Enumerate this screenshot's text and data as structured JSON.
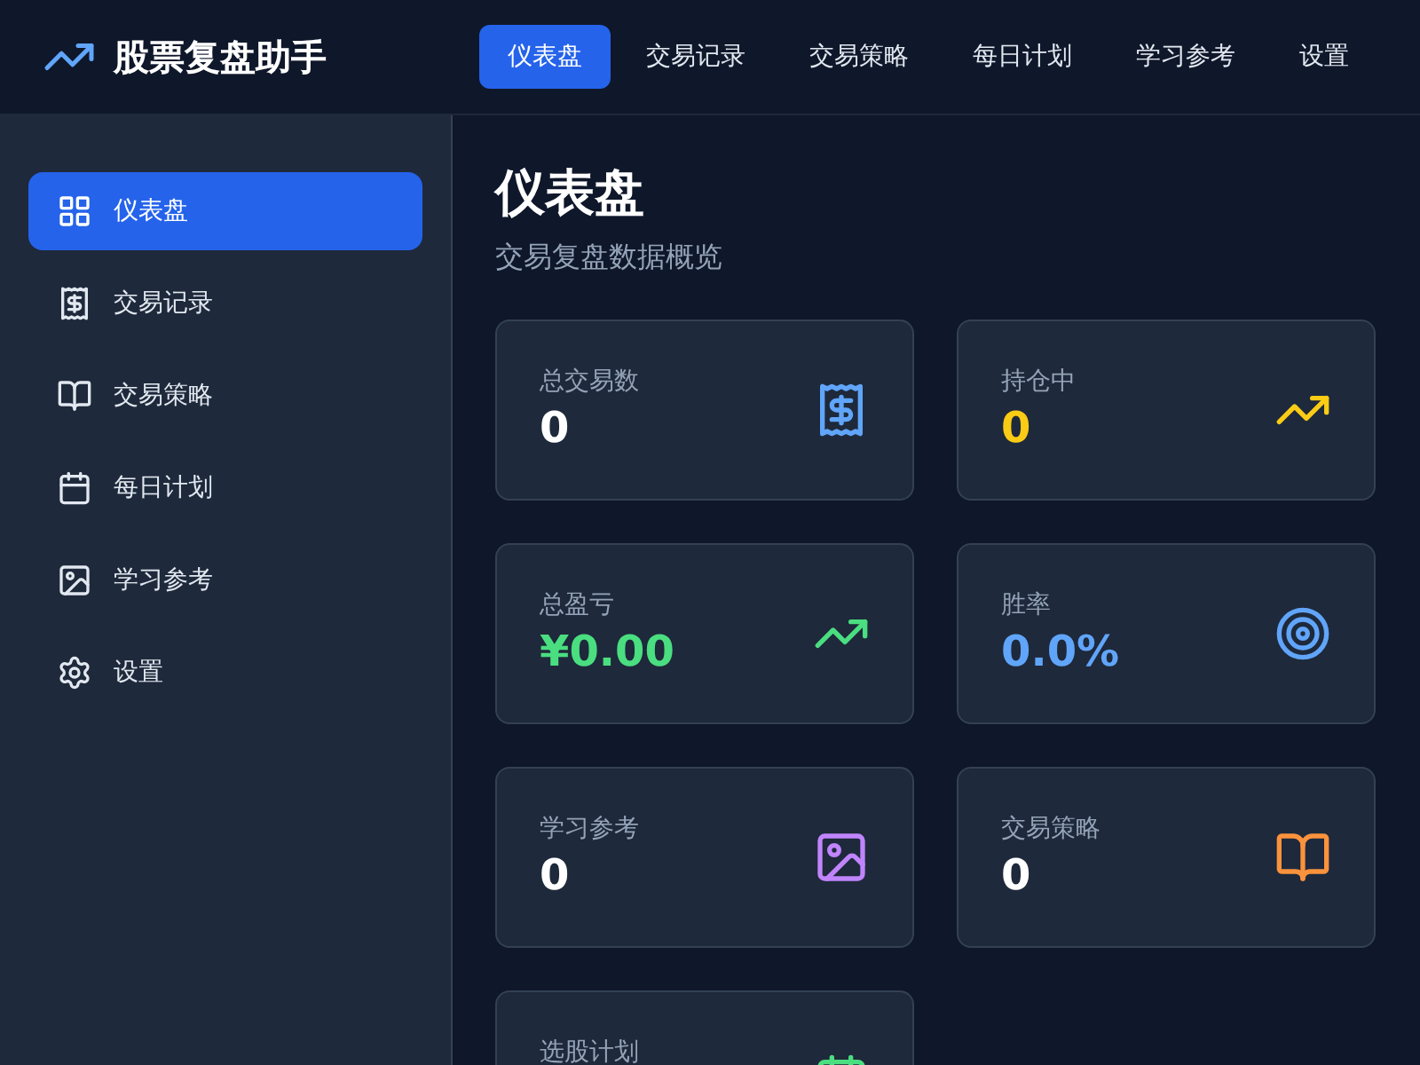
{
  "app": {
    "title": "股票复盘助手"
  },
  "nav": [
    {
      "label": "仪表盘",
      "selected": true
    },
    {
      "label": "交易记录",
      "selected": false
    },
    {
      "label": "交易策略",
      "selected": false
    },
    {
      "label": "每日计划",
      "selected": false
    },
    {
      "label": "学习参考",
      "selected": false
    },
    {
      "label": "设置",
      "selected": false
    }
  ],
  "sidebar": {
    "items": [
      {
        "label": "仪表盘",
        "kind": "grid",
        "selected": true
      },
      {
        "label": "交易记录",
        "kind": "receipt",
        "selected": false
      },
      {
        "label": "交易策略",
        "kind": "book",
        "selected": false
      },
      {
        "label": "每日计划",
        "kind": "calendar",
        "selected": false
      },
      {
        "label": "学习参考",
        "kind": "image",
        "selected": false
      },
      {
        "label": "设置",
        "kind": "settings",
        "selected": false
      }
    ]
  },
  "page": {
    "title": "仪表盘",
    "subtitle": "交易复盘数据概览"
  },
  "cards": [
    {
      "label": "总交易数",
      "value": "0",
      "kind": "receipt",
      "color": "#60a5fa",
      "value_colored": false
    },
    {
      "label": "持仓中",
      "value": "0",
      "kind": "trend",
      "color": "#facc15",
      "value_colored": true
    },
    {
      "label": "总盈亏",
      "value": "¥0.00",
      "kind": "trend",
      "color": "#4ade80",
      "value_colored": true
    },
    {
      "label": "胜率",
      "value": "0.0%",
      "kind": "target",
      "color": "#60a5fa",
      "value_colored": true
    },
    {
      "label": "学习参考",
      "value": "0",
      "kind": "image",
      "color": "#c084fc",
      "value_colored": false
    },
    {
      "label": "交易策略",
      "value": "0",
      "kind": "book",
      "color": "#fb923c",
      "value_colored": false
    },
    {
      "label": "选股计划",
      "kind": "calendar",
      "color": "#4ade80"
    }
  ]
}
